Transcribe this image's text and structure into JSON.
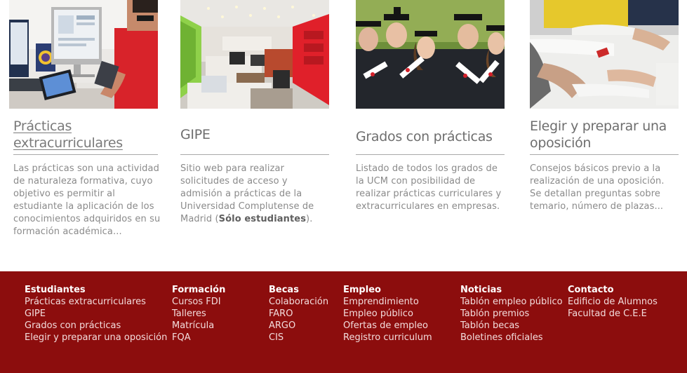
{
  "cards": [
    {
      "title": "Prácticas extracurriculares",
      "description": "Las prácticas son una actividad de naturaleza formativa, cuyo objetivo es permitir al estudiante la aplicación de los conocimientos adquiridos en su formación académica..."
    },
    {
      "title": "GIPE",
      "description_pre": "Sitio web para realizar solicitudes de acceso y admisión a prácticas de la Universidad Complutense de Madrid (",
      "description_bold": "Sólo estudiantes",
      "description_post": ")."
    },
    {
      "title": "Grados con prácticas",
      "description": "Listado de todos los grados de la UCM con posibilidad de realizar prácticas curriculares y extracurriculares en empresas."
    },
    {
      "title": "Elegir y preparar una oposición",
      "description": "Consejos básicos previo a la realización de una oposición. Se detallan preguntas sobre temario, número de plazas..."
    }
  ],
  "footer": {
    "columns": [
      {
        "heading": "Estudiantes",
        "links": [
          "Prácticas extracurriculares",
          "GIPE",
          "Grados con prácticas",
          "Elegir y preparar una oposición"
        ]
      },
      {
        "heading": "Formación",
        "links": [
          "Cursos FDI",
          "Talleres",
          "Matrícula",
          "FQA"
        ]
      },
      {
        "heading": "Becas",
        "links": [
          "Colaboración",
          "FARO",
          "ARGO",
          "CIS"
        ]
      },
      {
        "heading": "Empleo",
        "links": [
          "Emprendimiento",
          "Empleo público",
          "Ofertas de empleo",
          "Registro curriculum"
        ]
      },
      {
        "heading": "Noticias",
        "links": [
          "Tablón empleo público",
          "Tablón premios",
          "Tablón becas",
          "Boletines oficiales"
        ]
      },
      {
        "heading": "Contacto",
        "links": [
          "Edificio de Alumnos",
          "Facultad de C.E.E"
        ]
      }
    ]
  },
  "colors": {
    "footer_bg": "#8c0d0d",
    "footer_link": "#f3dcdc",
    "card_text": "#8a8a8a",
    "rule": "#a8a8a8"
  }
}
